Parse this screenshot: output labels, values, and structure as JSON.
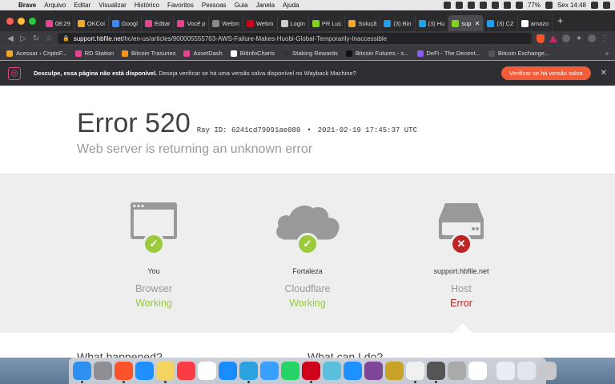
{
  "menubar": {
    "app": "Brave",
    "items": [
      "Arquivo",
      "Editar",
      "Visualizar",
      "Histórico",
      "Favoritos",
      "Pessoas",
      "Guia",
      "Janela",
      "Ajuda"
    ],
    "battery": "77%",
    "clock": "Sex 14:48"
  },
  "tabs": [
    {
      "label": "08:29",
      "color": "#e84393"
    },
    {
      "label": "OKCoi",
      "color": "#f5a623"
    },
    {
      "label": "Googl",
      "color": "#4285f4"
    },
    {
      "label": "Editar",
      "color": "#e84393"
    },
    {
      "label": "Você p",
      "color": "#e84393"
    },
    {
      "label": "Webm",
      "color": "#888888"
    },
    {
      "label": "Webm",
      "color": "#d0021b"
    },
    {
      "label": "Login",
      "color": "#cccccc"
    },
    {
      "label": "PR Luc",
      "color": "#7ed321"
    },
    {
      "label": "Soluçã",
      "color": "#f5a623"
    },
    {
      "label": "(3) Bin",
      "color": "#1da1f2"
    },
    {
      "label": "(3) Hu",
      "color": "#1da1f2"
    },
    {
      "label": "sup",
      "color": "#7ed321",
      "active": true
    },
    {
      "label": "(3) CZ",
      "color": "#1da1f2"
    },
    {
      "label": "amazo",
      "color": "#ffffff"
    }
  ],
  "address": {
    "host": "support.hbfile.net",
    "path": "/hc/en-us/articles/900005555763-AWS-Failure-Makes-Huobi-Global-Temporarily-Inaccessible"
  },
  "bookmarks": [
    {
      "label": "Acessar ‹ CriptoF...",
      "color": "#f5a623"
    },
    {
      "label": "RD Station",
      "color": "#e84393"
    },
    {
      "label": "Bitcoin Trasuries",
      "color": "#f7931a"
    },
    {
      "label": "AssetDash",
      "color": "#e84393"
    },
    {
      "label": "BitInfoCharts",
      "color": "#ffffff"
    },
    {
      "label": "Staking Rewards",
      "color": "#333333"
    },
    {
      "label": "Bitcoin Futures - s...",
      "color": "#111111"
    },
    {
      "label": "DeFi - The Decent...",
      "color": "#8b5cf6"
    },
    {
      "label": "Bitcoin Exchange...",
      "color": "#555555"
    }
  ],
  "infobar": {
    "bold": "Desculpe, essa página não está disponível.",
    "text": " Deseja verificar se há uma versão salva disponível no Wayback Machine?",
    "button": "Verificar se há versão salva"
  },
  "error": {
    "code": "Error 520",
    "ray": "Ray ID: 6241cd79091ae080",
    "time": "2021-02-19 17:45:37 UTC",
    "subtitle": "Web server is returning an unknown error"
  },
  "status": [
    {
      "who": "You",
      "what": "Browser",
      "state": "Working",
      "ok": true
    },
    {
      "who": "Fortaleza",
      "what": "Cloudflare",
      "state": "Working",
      "ok": true
    },
    {
      "who": "support.hbfile.net",
      "what": "Host",
      "state": "Error",
      "ok": false
    }
  ],
  "lower": {
    "left": "What happened?",
    "right": "What can I do?"
  },
  "colors": {
    "ok": "#9bca3e",
    "error": "#bd2426"
  }
}
